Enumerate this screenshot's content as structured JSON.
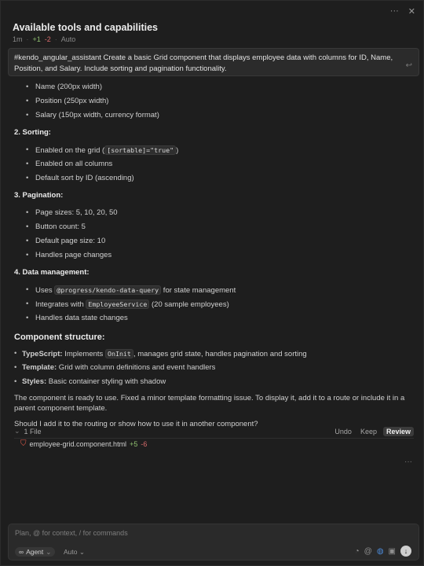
{
  "header": {
    "title": "Available tools and capabilities",
    "age": "1m",
    "added": "+1",
    "removed": "-2",
    "mode": "Auto"
  },
  "prompt": {
    "text": "#kendo_angular_assistant Create a basic Grid component that displays employee data with columns for ID, Name, Position, and Salary. Include sorting and pagination functionality."
  },
  "columns": [
    "Name (200px width)",
    "Position (250px width)",
    "Salary (150px width, currency format)"
  ],
  "sorting": {
    "heading": "2. Sorting:",
    "enabled_pre": "Enabled on the grid (",
    "enabled_code": "[sortable]=\"true\"",
    "enabled_post": ")",
    "all": "Enabled on all columns",
    "default": "Default sort by ID (ascending)"
  },
  "pagination": {
    "heading": "3. Pagination:",
    "items": [
      "Page sizes: 5, 10, 20, 50",
      "Button count: 5",
      "Default page size: 10",
      "Handles page changes"
    ]
  },
  "data_mgmt": {
    "heading": "4. Data management:",
    "uses_pre": "Uses ",
    "uses_code": "@progress/kendo-data-query",
    "uses_post": " for state management",
    "int_pre": "Integrates with ",
    "int_code": "EmployeeService",
    "int_post": " (20 sample employees)",
    "handles": "Handles data state changes"
  },
  "structure": {
    "heading": "Component structure:",
    "ts_label": "TypeScript:",
    "ts_pre": " Implements ",
    "ts_code": "OnInit",
    "ts_post": ", manages grid state, handles pagination and sorting",
    "tpl_label": "Template:",
    "tpl_text": " Grid with column definitions and event handlers",
    "sty_label": "Styles:",
    "sty_text": " Basic container styling with shadow"
  },
  "summary": "The component is ready to use. Fixed a minor template formatting issue. To display it, add it to a route or include it in a parent component template.",
  "question": "Should I add it to the routing or show how to use it in another component?",
  "files": {
    "count_label": "1 File",
    "undo": "Undo",
    "keep": "Keep",
    "review": "Review",
    "name": "employee-grid.component.html",
    "added": "+5",
    "removed": "-6"
  },
  "composer": {
    "placeholder": "Plan, @ for context, / for commands",
    "agent": "Agent",
    "model": "Auto"
  },
  "icons": [
    "more-icon",
    "close-icon",
    "undo-icon",
    "chevron-down-icon",
    "html-file-icon",
    "infinity-icon",
    "at-icon",
    "globe-icon",
    "image-icon",
    "send-icon"
  ],
  "colors": {
    "background": "#1e1e1e",
    "added": "#8fbf6f",
    "removed": "#d86b6b",
    "html_icon": "#e45b4a",
    "globe": "#4c8ad8"
  }
}
